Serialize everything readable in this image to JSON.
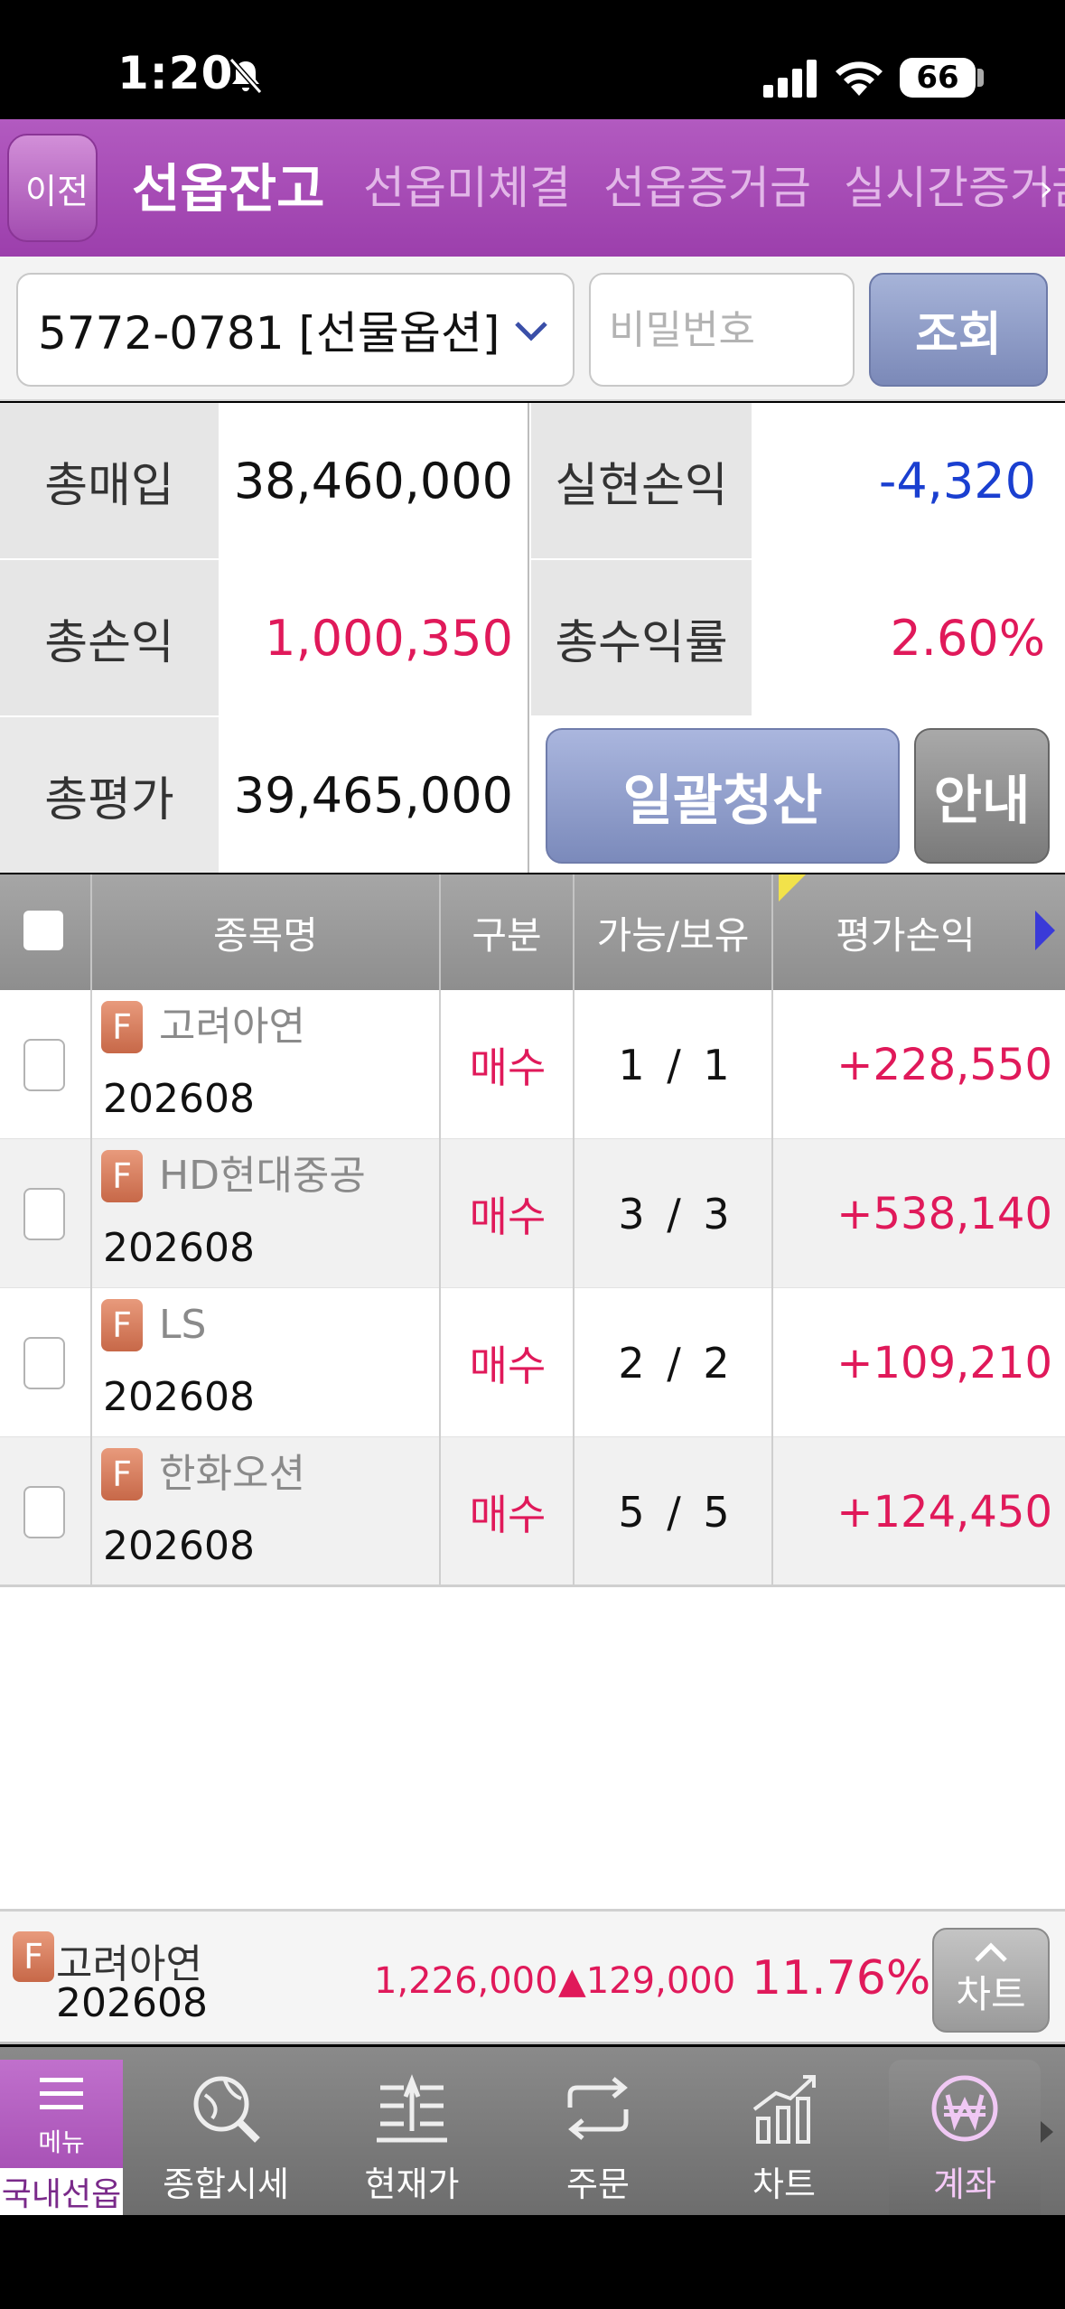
{
  "status_bar": {
    "time": "1:20",
    "battery": "66"
  },
  "tabs": {
    "back_label": "이전",
    "items": [
      {
        "label": "선옵잔고",
        "active": true
      },
      {
        "label": "선옵미체결",
        "active": false
      },
      {
        "label": "선옵증거금",
        "active": false
      },
      {
        "label": "실시간증거금",
        "active": false
      }
    ]
  },
  "account": {
    "selected": "5772-0781 [선물옵션]",
    "password_placeholder": "비밀번호",
    "query_label": "조회"
  },
  "summary": {
    "total_buy_label": "총매입",
    "total_buy": "38,460,000",
    "realized_pnl_label": "실현손익",
    "realized_pnl": "-4,320",
    "total_pnl_label": "총손익",
    "total_pnl": "1,000,350",
    "total_return_label": "총수익률",
    "total_return": "2.60%",
    "total_eval_label": "총평가",
    "total_eval": "39,465,000",
    "liquidate_label": "일괄청산",
    "guide_label": "안내"
  },
  "table": {
    "headers": [
      "종목명",
      "구분",
      "가능/보유",
      "평가손익"
    ],
    "badge": "F",
    "rows": [
      {
        "name": "고려아연",
        "code": "202608",
        "side": "매수",
        "qty": "1 / 1",
        "pnl": "+228,550"
      },
      {
        "name": "HD현대중공",
        "code": "202608",
        "side": "매수",
        "qty": "3 / 3",
        "pnl": "+538,140"
      },
      {
        "name": "LS",
        "code": "202608",
        "side": "매수",
        "qty": "2 / 2",
        "pnl": "+109,210"
      },
      {
        "name": "한화오션",
        "code": "202608",
        "side": "매수",
        "qty": "5 / 5",
        "pnl": "+124,450"
      }
    ]
  },
  "ticker": {
    "badge": "F",
    "name": "고려아연",
    "code": "202608",
    "price": "1,226,000",
    "change": "▲129,000",
    "rate": "11.76%",
    "chart_label": "차트"
  },
  "bottom_nav": {
    "menu_label": "메뉴",
    "menu_sub": "국내선옵",
    "items": [
      {
        "label": "종합시세",
        "icon": "globe-search-icon"
      },
      {
        "label": "현재가",
        "icon": "price-list-icon"
      },
      {
        "label": "주문",
        "icon": "refresh-arrows-icon"
      },
      {
        "label": "차트",
        "icon": "bar-chart-icon"
      },
      {
        "label": "계좌",
        "icon": "won-coin-icon"
      }
    ]
  },
  "colors": {
    "accent": "#9c3fac",
    "up": "#e0195a",
    "down": "#1a3fd0"
  }
}
